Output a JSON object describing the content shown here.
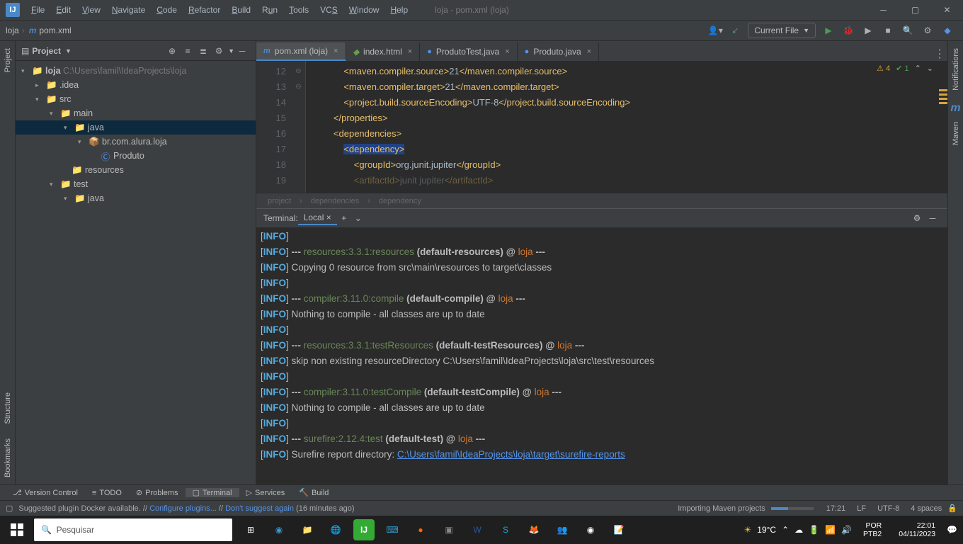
{
  "titlebar": {
    "logo": "IJ",
    "menus": [
      "File",
      "Edit",
      "View",
      "Navigate",
      "Code",
      "Refactor",
      "Build",
      "Run",
      "Tools",
      "VCS",
      "Window",
      "Help"
    ],
    "doc": "loja - pom.xml (loja)"
  },
  "nav": {
    "crumbs": [
      "loja",
      "pom.xml"
    ],
    "run_config": "Current File"
  },
  "project_panel": {
    "title": "Project"
  },
  "tree": {
    "root": {
      "name": "loja",
      "path": "C:\\Users\\famil\\IdeaProjects\\loja"
    },
    "idea": ".idea",
    "src": "src",
    "main": "main",
    "java": "java",
    "pkg": "br.com.alura.loja",
    "cls": "Produto",
    "resources": "resources",
    "test": "test",
    "java2": "java"
  },
  "tabs": [
    {
      "icon": "m",
      "label": "pom.xml (loja)",
      "active": true,
      "color": "#4a88c7"
    },
    {
      "icon": "◆",
      "label": "index.html",
      "active": false,
      "color": "#6a9e4e"
    },
    {
      "icon": "●",
      "label": "ProdutoTest.java",
      "active": false,
      "color": "#5394ec"
    },
    {
      "icon": "●",
      "label": "Produto.java",
      "active": false,
      "color": "#5394ec"
    }
  ],
  "code": {
    "lines": [
      "12",
      "13",
      "14",
      "15",
      "16",
      "17",
      "18",
      "19"
    ],
    "content": [
      {
        "indent": "            ",
        "open": "<maven.compiler.source>",
        "val": "21",
        "close": "</maven.compiler.source>"
      },
      {
        "indent": "            ",
        "open": "<maven.compiler.target>",
        "val": "21",
        "close": "</maven.compiler.target>"
      },
      {
        "indent": "            ",
        "open": "<project.build.sourceEncoding>",
        "val": "UTF-8",
        "close": "</project.build.sourceEncoding>"
      },
      {
        "indent": "        ",
        "open": "",
        "val": "",
        "close": "</properties>"
      },
      {
        "indent": "        ",
        "open": "<dependencies>",
        "val": "",
        "close": ""
      },
      {
        "indent": "            ",
        "open": "<dependency>",
        "val": "",
        "close": "",
        "hl": true
      },
      {
        "indent": "                ",
        "open": "<groupId>",
        "val": "org.junit.jupiter",
        "close": "</groupId>"
      },
      {
        "indent": "                ",
        "open": "<artifactId>",
        "val": "junit jupiter",
        "close": "</artifactId>",
        "faded": true
      }
    ],
    "warn_count": "4",
    "ok_count": "1"
  },
  "breadcrumbs": [
    "project",
    "dependencies",
    "dependency"
  ],
  "terminal": {
    "title": "Terminal:",
    "tab": "Local",
    "lines": [
      {
        "t": "info"
      },
      {
        "t": "goal",
        "plugin": "resources:3.3.1:resources",
        "exec": "(default-resources)",
        "proj": "loja"
      },
      {
        "t": "msg",
        "text": "Copying 0 resource from src\\main\\resources to target\\classes"
      },
      {
        "t": "info"
      },
      {
        "t": "goal",
        "plugin": "compiler:3.11.0:compile",
        "exec": "(default-compile)",
        "proj": "loja"
      },
      {
        "t": "msg",
        "text": "Nothing to compile - all classes are up to date"
      },
      {
        "t": "info"
      },
      {
        "t": "goal",
        "plugin": "resources:3.3.1:testResources",
        "exec": "(default-testResources)",
        "proj": "loja"
      },
      {
        "t": "msg",
        "text": "skip non existing resourceDirectory C:\\Users\\famil\\IdeaProjects\\loja\\src\\test\\resources"
      },
      {
        "t": "info"
      },
      {
        "t": "goal",
        "plugin": "compiler:3.11.0:testCompile",
        "exec": "(default-testCompile)",
        "proj": "loja"
      },
      {
        "t": "msg",
        "text": "Nothing to compile - all classes are up to date"
      },
      {
        "t": "info"
      },
      {
        "t": "goal",
        "plugin": "surefire:2.12.4:test",
        "exec": "(default-test)",
        "proj": "loja"
      },
      {
        "t": "link",
        "text": "Surefire report directory: ",
        "url": "C:\\Users\\famil\\IdeaProjects\\loja\\target\\surefire-reports"
      },
      {
        "t": "blank"
      },
      {
        "t": "dash"
      }
    ]
  },
  "bottom_tools": [
    "Version Control",
    "TODO",
    "Problems",
    "Terminal",
    "Services",
    "Build"
  ],
  "status": {
    "msg": "Suggested plugin Docker available. // ",
    "l1": "Configure plugins...",
    "sep": " // ",
    "l2": "Don't suggest again",
    "age": " (16 minutes ago)",
    "import": "Importing Maven projects",
    "pos": "17:21",
    "eol": "LF",
    "enc": "UTF-8",
    "indent": "4 spaces"
  },
  "taskbar": {
    "search_ph": "Pesquisar",
    "weather": "19°C",
    "lang1": "POR",
    "lang2": "PTB2",
    "time": "22:01",
    "date": "04/11/2023"
  }
}
